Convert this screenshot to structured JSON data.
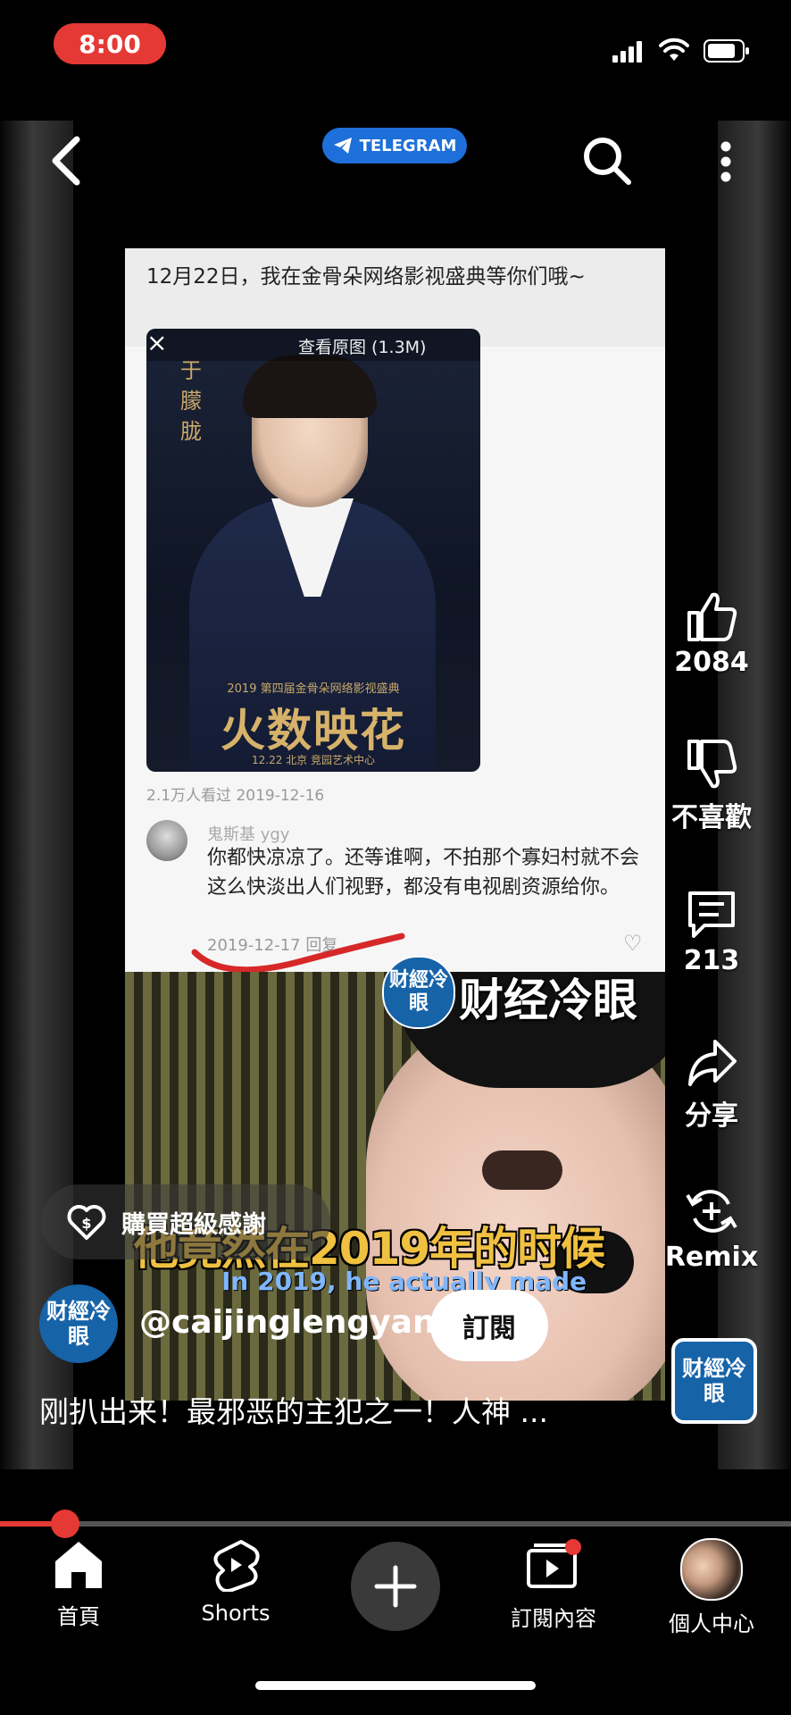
{
  "status_bar": {
    "time": "8:00"
  },
  "top_bar": {
    "telegram_label": "TELEGRAM"
  },
  "screenshot_content": {
    "header_text": "12月22日，我在金骨朵网络影视盛典等你们哦~",
    "view_original": "查看原图 (1.3M)",
    "poster_name": "于朦胧",
    "poster_subtitle": "2019 第四届金骨朵网络影视盛典",
    "poster_logo": "火数映花",
    "poster_date": "12.22 北京 竞园艺术中心",
    "views_line": "2.1万人看过   2019-12-16",
    "comment_user": "鬼斯基 ygy",
    "comment_body": "你都快凉凉了。还等谁啊，不拍那个寡妇村就不会这么快淡出人们视野，都没有电视剧资源给你。",
    "comment_date": "2019-12-17   回复"
  },
  "watermark": {
    "logo_text": "财經冷眼",
    "name": "财经冷眼"
  },
  "subtitles": {
    "zh": "他竟然在2019年的时候",
    "en": "In 2019, he actually made"
  },
  "actions": {
    "like_count": "2084",
    "dislike_label": "不喜歡",
    "comment_count": "213",
    "share_label": "分享",
    "remix_label": "Remix"
  },
  "overlay": {
    "super_thanks": "購買超級感謝",
    "channel_avatar_text": "财經冷眼",
    "channel_handle": "@caijinglengyan",
    "subscribe": "訂閱",
    "video_title": "刚扒出来！最邪恶的主犯之一！人神 ...",
    "sound_avatar_text": "财經冷眼"
  },
  "playback": {
    "progress_fraction": 0.082
  },
  "bottom_nav": {
    "home": "首頁",
    "shorts": "Shorts",
    "subscriptions": "訂閱內容",
    "you": "個人中心"
  },
  "colors": {
    "accent_red": "#e53935",
    "telegram_blue": "#1e6fd9",
    "channel_blue": "#1663a8",
    "subtitle_yellow": "#f0c040"
  }
}
